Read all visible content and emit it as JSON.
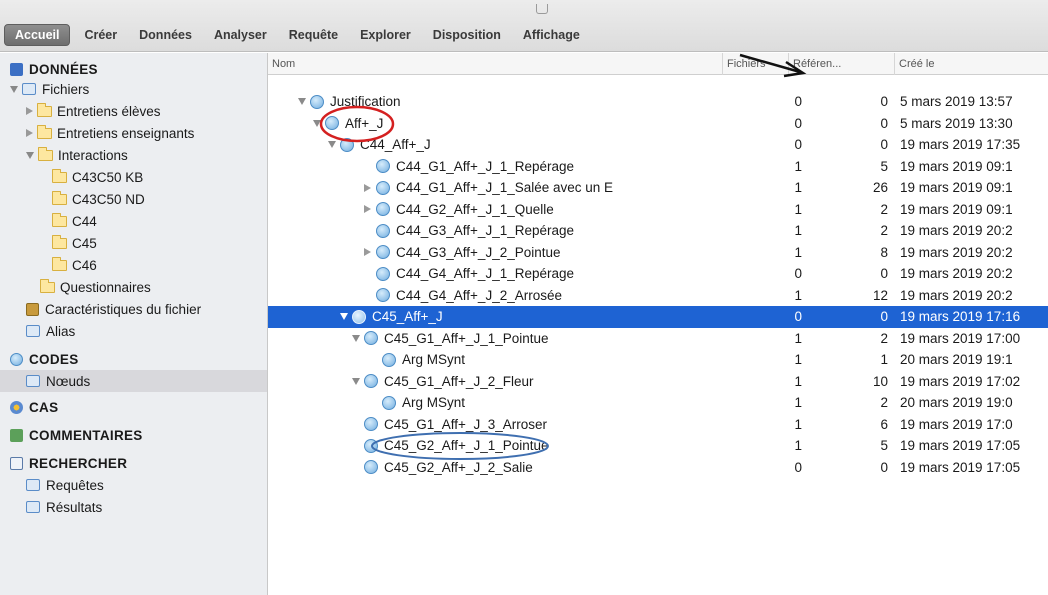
{
  "toolbar": {
    "tabs": [
      "Accueil",
      "Créer",
      "Données",
      "Analyser",
      "Requête",
      "Explorer",
      "Disposition",
      "Affichage"
    ]
  },
  "sidebar": {
    "donnees": "DONNÉES",
    "fichiers": "Fichiers",
    "entretiens_eleves": "Entretiens élèves",
    "entretiens_enseignants": "Entretiens enseignants",
    "interactions": "Interactions",
    "folders": [
      "C43C50 KB",
      "C43C50 ND",
      "C44",
      "C45",
      "C46"
    ],
    "questionnaires": "Questionnaires",
    "caracteristiques": "Caractéristiques du fichier",
    "alias": "Alias",
    "codes": "CODES",
    "noeuds": "Nœuds",
    "cas": "CAS",
    "commentaires": "COMMENTAIRES",
    "rechercher": "RECHERCHER",
    "requetes": "Requêtes",
    "resultats": "Résultats"
  },
  "columns": {
    "nom": "Nom",
    "fichiers": "Fichiers",
    "references": "Référen...",
    "cree_le": "Créé le"
  },
  "rows": [
    {
      "name": "Justification",
      "files": "0",
      "refs": "0",
      "date": "5 mars 2019 13:57"
    },
    {
      "name": "Aff+_J",
      "files": "0",
      "refs": "0",
      "date": "5 mars 2019 13:30"
    },
    {
      "name": "C44_Aff+_J",
      "files": "0",
      "refs": "0",
      "date": "19 mars 2019 17:35"
    },
    {
      "name": "C44_G1_Aff+_J_1_Repérage",
      "files": "1",
      "refs": "5",
      "date": "19 mars 2019 09:1"
    },
    {
      "name": "C44_G1_Aff+_J_1_Salée avec un E",
      "files": "1",
      "refs": "26",
      "date": "19 mars 2019 09:1"
    },
    {
      "name": "C44_G2_Aff+_J_1_Quelle",
      "files": "1",
      "refs": "2",
      "date": "19 mars 2019 09:1"
    },
    {
      "name": "C44_G3_Aff+_J_1_Repérage",
      "files": "1",
      "refs": "2",
      "date": "19 mars 2019 20:2"
    },
    {
      "name": "C44_G3_Aff+_J_2_Pointue",
      "files": "1",
      "refs": "8",
      "date": "19 mars 2019 20:2"
    },
    {
      "name": "C44_G4_Aff+_J_1_Repérage",
      "files": "0",
      "refs": "0",
      "date": "19 mars 2019 20:2"
    },
    {
      "name": "C44_G4_Aff+_J_2_Arrosée",
      "files": "1",
      "refs": "12",
      "date": "19 mars 2019 20:2"
    },
    {
      "name": "C45_Aff+_J",
      "files": "0",
      "refs": "0",
      "date": "19 mars 2019 17:16"
    },
    {
      "name": "C45_G1_Aff+_J_1_Pointue",
      "files": "1",
      "refs": "2",
      "date": "19 mars 2019 17:00"
    },
    {
      "name": "Arg MSynt",
      "files": "1",
      "refs": "1",
      "date": "20 mars 2019 19:1"
    },
    {
      "name": "C45_G1_Aff+_J_2_Fleur",
      "files": "1",
      "refs": "10",
      "date": "19 mars 2019 17:02"
    },
    {
      "name": "Arg MSynt",
      "files": "1",
      "refs": "2",
      "date": "20 mars 2019 19:0"
    },
    {
      "name": "C45_G1_Aff+_J_3_Arroser",
      "files": "1",
      "refs": "6",
      "date": "19 mars 2019 17:0"
    },
    {
      "name": "C45_G2_Aff+_J_1_Pointue",
      "files": "1",
      "refs": "5",
      "date": "19 mars 2019 17:05"
    },
    {
      "name": "C45_G2_Aff+_J_2_Salie",
      "files": "0",
      "refs": "0",
      "date": "19 mars 2019 17:05"
    }
  ],
  "colors": {
    "selection": "#1e63d3",
    "annotation_red": "#d42020",
    "annotation_blue": "#3f6fb0"
  }
}
